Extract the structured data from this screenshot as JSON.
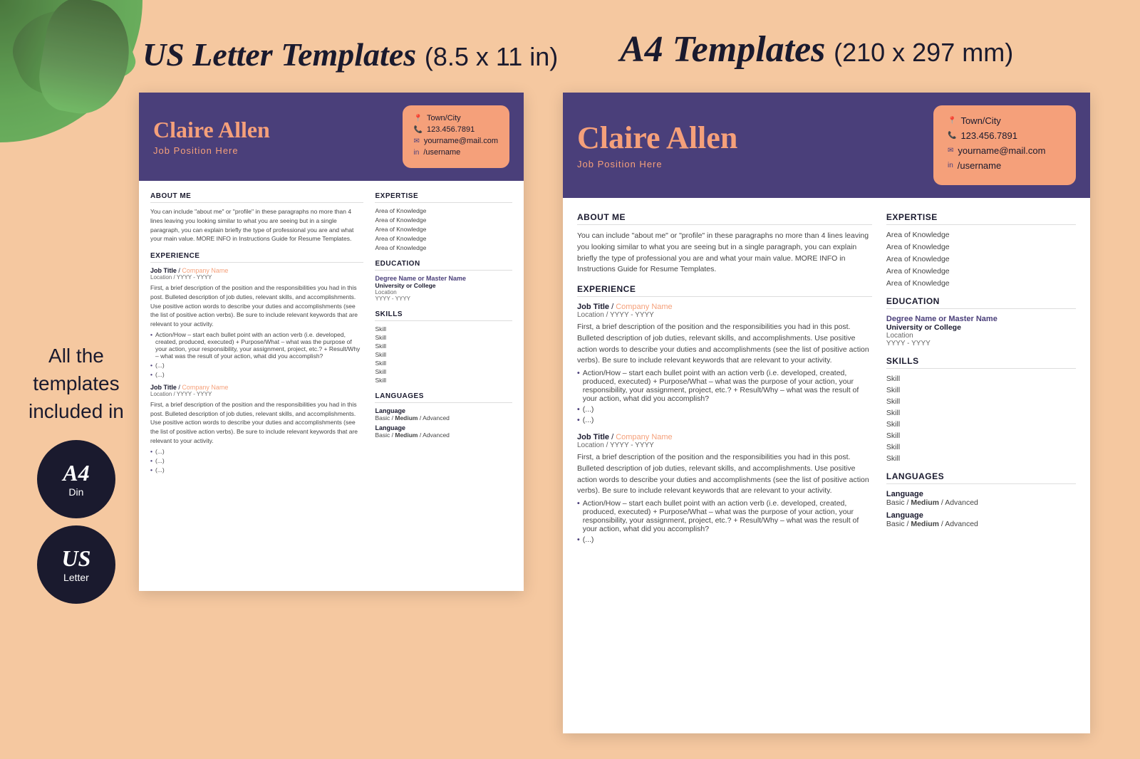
{
  "page": {
    "background_color": "#f5c8a0"
  },
  "header": {
    "us_title_script": "US Letter Templates",
    "us_title_size": "(8.5 x 11 in)",
    "a4_title_script": "A4 Templates",
    "a4_title_size": "(210 x 297 mm)"
  },
  "side_labels": {
    "all_text": "All the\ntemplates\nincluded in",
    "a4_badge_main": "A4",
    "a4_badge_sub": "Din",
    "us_badge_main": "US",
    "us_badge_sub": "Letter"
  },
  "resume": {
    "name": "Claire Allen",
    "job_position": "Job Position Here",
    "contact": {
      "town": "Town/City",
      "phone": "123.456.7891",
      "email": "yourname@mail.com",
      "linkedin": "/username"
    },
    "about_me_title": "ABOUT ME",
    "about_me_text": "You can include \"about me\" or \"profile\" in these paragraphs no more than 4 lines leaving you looking similar to what you are seeing but in a single paragraph, you can explain briefly the type of professional you are and what your main value. MORE INFO in Instructions Guide for Resume Templates.",
    "experience_title": "EXPERIENCE",
    "jobs": [
      {
        "title": "Job Title",
        "company": "Company Name",
        "location": "Location / YYYY - YYYY",
        "description": "First, a brief description of the position and the responsibilities you had in this post. Bulleted description of job duties, relevant skills, and accomplishments. Use positive action words to describe your duties and accomplishments (see the list of positive action verbs). Be sure to include relevant keywords that are relevant to your activity.",
        "bullets": [
          "Action/How – start each bullet point with an action verb (i.e. developed, created, produced, executed) + Purpose/What – what was the purpose of your action, your responsibility, your assignment, project, etc.? + Result/Why – what was the result of your action, what did you accomplish?",
          "(...)",
          "(...)"
        ]
      },
      {
        "title": "Job Title",
        "company": "Company Name",
        "location": "Location / YYYY - YYYY",
        "description": "First, a brief description of the position and the responsibilities you had in this post. Bulleted description of job duties, relevant skills, and accomplishments. Use positive action words to describe your duties and accomplishments (see the list of positive action verbs). Be sure to include relevant keywords that are relevant to your activity.",
        "bullets": [
          "(...)",
          "(...)",
          "(...)"
        ]
      }
    ],
    "expertise_title": "EXPERTISE",
    "expertise_items": [
      "Area of Knowledge",
      "Area of Knowledge",
      "Area of Knowledge",
      "Area of Knowledge",
      "Area of Knowledge"
    ],
    "education_title": "EDUCATION",
    "education": {
      "degree": "Degree Name or Master Name",
      "school": "University or College",
      "location": "Location",
      "years": "YYYY - YYYY"
    },
    "skills_title": "SKILLS",
    "skills": [
      "Skill",
      "Skill",
      "Skill",
      "Skill",
      "Skill",
      "Skill",
      "Skill"
    ],
    "languages_title": "LANGUAGES",
    "languages": [
      {
        "name": "Language",
        "level": "Basic / Medium / Advanced"
      },
      {
        "name": "Language",
        "level": "Basic / Medium / Advanced"
      }
    ]
  }
}
